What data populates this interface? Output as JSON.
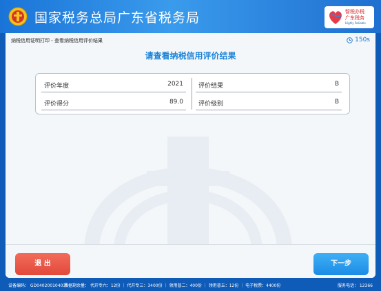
{
  "header": {
    "agency_name": "国家税务总局广东省税务局",
    "brand_line1": "智税办税",
    "brand_line2": "广东税务",
    "brand_sub": "Highly Reliable"
  },
  "page": {
    "breadcrumb": "纳税信用证明打印 - 查看纳税信用评价结果",
    "countdown": "150s",
    "heading": "请查看纳税信用评价结果"
  },
  "results": [
    {
      "key": "评价年度",
      "value": "2021"
    },
    {
      "key": "评价得分",
      "value": "89.0"
    },
    {
      "key": "评价结果",
      "value": "B"
    },
    {
      "key": "评价级别",
      "value": "B"
    }
  ],
  "buttons": {
    "exit": "退 出",
    "next": "下一步"
  },
  "statusbar": {
    "device": "设备编码： GD040200104035",
    "tickets": "票据剩余量： 代开专六：12份 ｜ 代开专三：3400份 ｜ 领用普二：400份 ｜ 领用普五：12份 ｜ 电子税票：4400份",
    "hotline": "服务电话： 12366"
  },
  "colors": {
    "header_bg": "#2a8ae6",
    "heading": "#1a83d8",
    "exit_button": "#e9523f",
    "next_button": "#2a9bef"
  }
}
